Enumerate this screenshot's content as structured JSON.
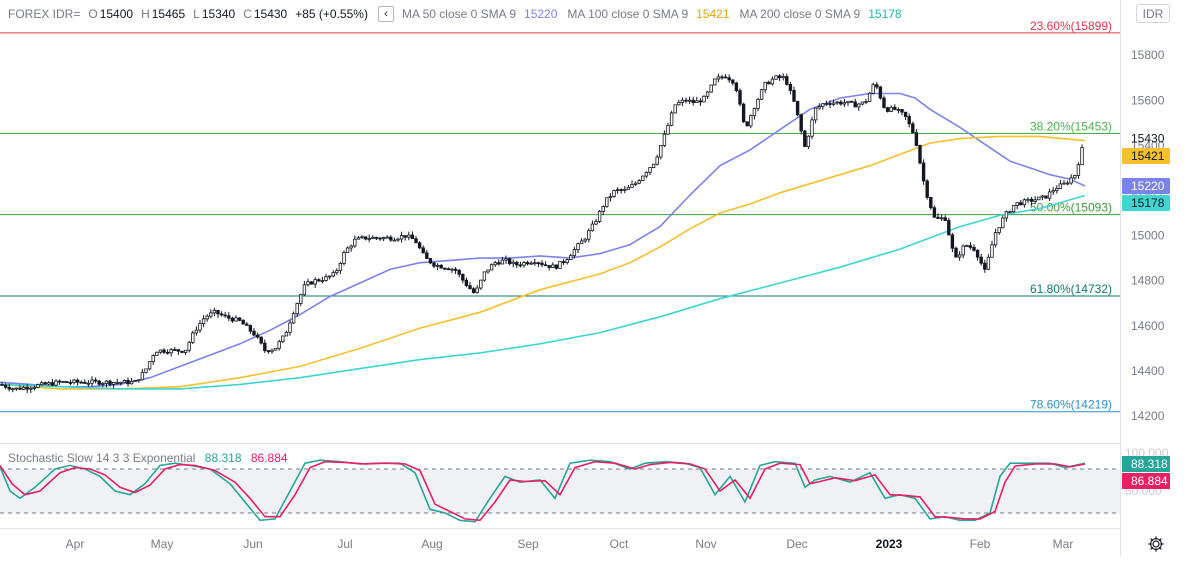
{
  "symbol": "FOREX IDR=",
  "ohlc": {
    "o_label": "O",
    "o": "15400",
    "h_label": "H",
    "h": "15465",
    "l_label": "L",
    "l": "15340",
    "c_label": "C",
    "c": "15430",
    "change": "+85 (+0.55%)"
  },
  "collapse_glyph": "‹",
  "currency_button": "IDR",
  "moving_averages": [
    {
      "name": "MA 50 close 0 SMA 9",
      "value": "15220",
      "color": "#7b83eb"
    },
    {
      "name": "MA 100 close 0 SMA 9",
      "value": "15421",
      "color": "#f5c02c"
    },
    {
      "name": "MA 200 close 0 SMA 9",
      "value": "15178",
      "color": "#3dd6d0"
    }
  ],
  "price_axis": {
    "ticks": [
      "15800",
      "15600",
      "15400",
      "15200",
      "15000",
      "14800",
      "14600",
      "14400",
      "14200"
    ],
    "last_price": "15430",
    "badges": [
      {
        "text": "15421",
        "bg": "#f5c02c",
        "color": "#131722"
      },
      {
        "text": "15220",
        "bg": "#7b83eb",
        "color": "#ffffff"
      },
      {
        "text": "15178",
        "bg": "#3dd6d0",
        "color": "#131722"
      }
    ]
  },
  "fib_levels": [
    {
      "label": "23.60%(15899)",
      "value": 15899,
      "color": "#e0364a"
    },
    {
      "label": "38.20%(15453)",
      "value": 15453,
      "color": "#4caf50"
    },
    {
      "label": "50.00%(15093)",
      "value": 15093,
      "color": "#3d9a3d"
    },
    {
      "label": "61.80%(14732)",
      "value": 14732,
      "color": "#0e7a6e"
    },
    {
      "label": "78.60%(14219)",
      "value": 14219,
      "color": "#2f8fd0"
    }
  ],
  "stochastic": {
    "name": "Stochastic Slow 14 3 3 Exponential",
    "k": "88.318",
    "d": "86.884",
    "k_color": "#26a69a",
    "d_color": "#e91e63",
    "axis_ticks": [
      "100.000",
      "50.000"
    ],
    "upper_band": 80,
    "lower_band": 20
  },
  "time_axis": [
    "Apr",
    "May",
    "Jun",
    "Jul",
    "Aug",
    "Sep",
    "Oct",
    "Nov",
    "Dec",
    "2023",
    "Feb",
    "Mar"
  ],
  "chart_data": {
    "type": "candlestick",
    "title": "",
    "ylim": [
      14170,
      15930
    ],
    "series": [
      {
        "name": "MA 50 close 0 SMA 9",
        "points": [
          [
            0,
            14350
          ],
          [
            30,
            14340
          ],
          [
            60,
            14330
          ],
          [
            90,
            14330
          ],
          [
            120,
            14340
          ],
          [
            150,
            14370
          ],
          [
            180,
            14420
          ],
          [
            210,
            14470
          ],
          [
            240,
            14520
          ],
          [
            270,
            14580
          ],
          [
            300,
            14650
          ],
          [
            330,
            14730
          ],
          [
            360,
            14790
          ],
          [
            390,
            14850
          ],
          [
            420,
            14880
          ],
          [
            450,
            14890
          ],
          [
            480,
            14900
          ],
          [
            510,
            14900
          ],
          [
            540,
            14910
          ],
          [
            570,
            14900
          ],
          [
            600,
            14920
          ],
          [
            630,
            14960
          ],
          [
            660,
            15040
          ],
          [
            690,
            15180
          ],
          [
            720,
            15310
          ],
          [
            750,
            15380
          ],
          [
            780,
            15470
          ],
          [
            810,
            15560
          ],
          [
            840,
            15610
          ],
          [
            870,
            15630
          ],
          [
            900,
            15630
          ],
          [
            915,
            15610
          ],
          [
            930,
            15560
          ],
          [
            960,
            15480
          ],
          [
            990,
            15390
          ],
          [
            1010,
            15330
          ],
          [
            1030,
            15300
          ],
          [
            1050,
            15270
          ],
          [
            1070,
            15250
          ],
          [
            1085,
            15220
          ]
        ]
      },
      {
        "name": "MA 100 close 0 SMA 9",
        "points": [
          [
            0,
            14340
          ],
          [
            60,
            14320
          ],
          [
            120,
            14320
          ],
          [
            180,
            14330
          ],
          [
            240,
            14370
          ],
          [
            300,
            14420
          ],
          [
            360,
            14500
          ],
          [
            420,
            14590
          ],
          [
            480,
            14660
          ],
          [
            540,
            14760
          ],
          [
            600,
            14830
          ],
          [
            630,
            14880
          ],
          [
            660,
            14950
          ],
          [
            690,
            15030
          ],
          [
            720,
            15100
          ],
          [
            750,
            15140
          ],
          [
            780,
            15190
          ],
          [
            810,
            15230
          ],
          [
            840,
            15270
          ],
          [
            870,
            15310
          ],
          [
            900,
            15360
          ],
          [
            930,
            15410
          ],
          [
            960,
            15430
          ],
          [
            1000,
            15440
          ],
          [
            1040,
            15440
          ],
          [
            1085,
            15421
          ]
        ]
      },
      {
        "name": "MA 200 close 0 SMA 9",
        "points": [
          [
            0,
            14340
          ],
          [
            60,
            14330
          ],
          [
            120,
            14320
          ],
          [
            180,
            14320
          ],
          [
            240,
            14340
          ],
          [
            300,
            14370
          ],
          [
            360,
            14410
          ],
          [
            420,
            14450
          ],
          [
            480,
            14480
          ],
          [
            540,
            14520
          ],
          [
            600,
            14570
          ],
          [
            660,
            14640
          ],
          [
            720,
            14720
          ],
          [
            780,
            14790
          ],
          [
            840,
            14860
          ],
          [
            900,
            14940
          ],
          [
            960,
            15040
          ],
          [
            1000,
            15090
          ],
          [
            1040,
            15120
          ],
          [
            1085,
            15178
          ]
        ]
      }
    ],
    "candles_close_path": [
      [
        0,
        14340
      ],
      [
        15,
        14320
      ],
      [
        30,
        14330
      ],
      [
        45,
        14340
      ],
      [
        60,
        14350
      ],
      [
        75,
        14350
      ],
      [
        90,
        14350
      ],
      [
        105,
        14350
      ],
      [
        120,
        14350
      ],
      [
        135,
        14350
      ],
      [
        145,
        14400
      ],
      [
        155,
        14490
      ],
      [
        170,
        14490
      ],
      [
        185,
        14490
      ],
      [
        195,
        14580
      ],
      [
        205,
        14640
      ],
      [
        215,
        14660
      ],
      [
        225,
        14640
      ],
      [
        240,
        14620
      ],
      [
        255,
        14560
      ],
      [
        265,
        14490
      ],
      [
        275,
        14500
      ],
      [
        285,
        14560
      ],
      [
        295,
        14680
      ],
      [
        305,
        14780
      ],
      [
        315,
        14800
      ],
      [
        325,
        14810
      ],
      [
        335,
        14830
      ],
      [
        345,
        14930
      ],
      [
        355,
        14980
      ],
      [
        365,
        14990
      ],
      [
        375,
        14990
      ],
      [
        385,
        14990
      ],
      [
        395,
        14990
      ],
      [
        405,
        15000
      ],
      [
        415,
        14980
      ],
      [
        425,
        14900
      ],
      [
        435,
        14870
      ],
      [
        445,
        14860
      ],
      [
        455,
        14850
      ],
      [
        465,
        14790
      ],
      [
        475,
        14740
      ],
      [
        485,
        14840
      ],
      [
        495,
        14880
      ],
      [
        505,
        14890
      ],
      [
        515,
        14870
      ],
      [
        525,
        14880
      ],
      [
        535,
        14890
      ],
      [
        545,
        14870
      ],
      [
        555,
        14860
      ],
      [
        565,
        14890
      ],
      [
        575,
        14940
      ],
      [
        585,
        14990
      ],
      [
        595,
        15060
      ],
      [
        605,
        15150
      ],
      [
        615,
        15200
      ],
      [
        625,
        15200
      ],
      [
        635,
        15230
      ],
      [
        645,
        15280
      ],
      [
        655,
        15330
      ],
      [
        665,
        15450
      ],
      [
        675,
        15580
      ],
      [
        685,
        15600
      ],
      [
        695,
        15590
      ],
      [
        705,
        15610
      ],
      [
        715,
        15690
      ],
      [
        725,
        15710
      ],
      [
        735,
        15680
      ],
      [
        745,
        15470
      ],
      [
        755,
        15580
      ],
      [
        765,
        15670
      ],
      [
        775,
        15700
      ],
      [
        785,
        15700
      ],
      [
        795,
        15580
      ],
      [
        805,
        15390
      ],
      [
        815,
        15560
      ],
      [
        825,
        15590
      ],
      [
        835,
        15590
      ],
      [
        845,
        15590
      ],
      [
        855,
        15580
      ],
      [
        865,
        15590
      ],
      [
        875,
        15680
      ],
      [
        885,
        15560
      ],
      [
        895,
        15560
      ],
      [
        905,
        15530
      ],
      [
        915,
        15440
      ],
      [
        925,
        15210
      ],
      [
        935,
        15070
      ],
      [
        945,
        15080
      ],
      [
        955,
        14890
      ],
      [
        965,
        14960
      ],
      [
        975,
        14940
      ],
      [
        985,
        14840
      ],
      [
        995,
        15010
      ],
      [
        1005,
        15090
      ],
      [
        1015,
        15140
      ],
      [
        1025,
        15150
      ],
      [
        1035,
        15160
      ],
      [
        1045,
        15170
      ],
      [
        1055,
        15210
      ],
      [
        1065,
        15230
      ],
      [
        1075,
        15270
      ],
      [
        1085,
        15430
      ]
    ],
    "stochastic_k": [
      [
        0,
        83
      ],
      [
        10,
        50
      ],
      [
        20,
        40
      ],
      [
        35,
        55
      ],
      [
        55,
        80
      ],
      [
        70,
        85
      ],
      [
        85,
        80
      ],
      [
        100,
        70
      ],
      [
        115,
        50
      ],
      [
        130,
        45
      ],
      [
        145,
        60
      ],
      [
        160,
        85
      ],
      [
        175,
        88
      ],
      [
        190,
        85
      ],
      [
        210,
        80
      ],
      [
        230,
        60
      ],
      [
        245,
        35
      ],
      [
        260,
        10
      ],
      [
        275,
        12
      ],
      [
        290,
        50
      ],
      [
        305,
        88
      ],
      [
        320,
        92
      ],
      [
        340,
        90
      ],
      [
        360,
        87
      ],
      [
        380,
        88
      ],
      [
        400,
        88
      ],
      [
        415,
        75
      ],
      [
        430,
        25
      ],
      [
        445,
        20
      ],
      [
        460,
        10
      ],
      [
        475,
        8
      ],
      [
        490,
        40
      ],
      [
        505,
        70
      ],
      [
        520,
        62
      ],
      [
        540,
        65
      ],
      [
        555,
        40
      ],
      [
        570,
        88
      ],
      [
        590,
        92
      ],
      [
        610,
        90
      ],
      [
        630,
        80
      ],
      [
        645,
        88
      ],
      [
        665,
        90
      ],
      [
        685,
        88
      ],
      [
        700,
        82
      ],
      [
        715,
        45
      ],
      [
        730,
        70
      ],
      [
        745,
        35
      ],
      [
        760,
        85
      ],
      [
        775,
        90
      ],
      [
        795,
        88
      ],
      [
        805,
        55
      ],
      [
        815,
        65
      ],
      [
        830,
        70
      ],
      [
        850,
        62
      ],
      [
        870,
        75
      ],
      [
        885,
        40
      ],
      [
        900,
        45
      ],
      [
        915,
        40
      ],
      [
        930,
        12
      ],
      [
        945,
        15
      ],
      [
        960,
        10
      ],
      [
        975,
        10
      ],
      [
        990,
        20
      ],
      [
        1000,
        70
      ],
      [
        1010,
        88
      ],
      [
        1030,
        88
      ],
      [
        1050,
        88
      ],
      [
        1065,
        82
      ],
      [
        1085,
        88
      ]
    ],
    "stochastic_d": [
      [
        0,
        85
      ],
      [
        12,
        60
      ],
      [
        25,
        45
      ],
      [
        40,
        50
      ],
      [
        60,
        75
      ],
      [
        75,
        82
      ],
      [
        90,
        80
      ],
      [
        105,
        72
      ],
      [
        120,
        55
      ],
      [
        135,
        48
      ],
      [
        150,
        58
      ],
      [
        165,
        80
      ],
      [
        180,
        86
      ],
      [
        195,
        85
      ],
      [
        215,
        78
      ],
      [
        235,
        62
      ],
      [
        250,
        40
      ],
      [
        265,
        15
      ],
      [
        280,
        15
      ],
      [
        295,
        45
      ],
      [
        310,
        82
      ],
      [
        325,
        90
      ],
      [
        345,
        89
      ],
      [
        365,
        87
      ],
      [
        385,
        88
      ],
      [
        405,
        87
      ],
      [
        420,
        78
      ],
      [
        435,
        32
      ],
      [
        450,
        22
      ],
      [
        465,
        12
      ],
      [
        480,
        10
      ],
      [
        495,
        35
      ],
      [
        510,
        65
      ],
      [
        525,
        63
      ],
      [
        545,
        64
      ],
      [
        560,
        45
      ],
      [
        575,
        82
      ],
      [
        595,
        90
      ],
      [
        615,
        88
      ],
      [
        635,
        80
      ],
      [
        650,
        86
      ],
      [
        670,
        89
      ],
      [
        690,
        87
      ],
      [
        705,
        80
      ],
      [
        720,
        50
      ],
      [
        735,
        65
      ],
      [
        750,
        40
      ],
      [
        765,
        80
      ],
      [
        780,
        88
      ],
      [
        800,
        86
      ],
      [
        810,
        60
      ],
      [
        820,
        63
      ],
      [
        835,
        68
      ],
      [
        855,
        64
      ],
      [
        875,
        72
      ],
      [
        890,
        45
      ],
      [
        905,
        44
      ],
      [
        920,
        42
      ],
      [
        935,
        15
      ],
      [
        950,
        14
      ],
      [
        965,
        12
      ],
      [
        980,
        12
      ],
      [
        995,
        22
      ],
      [
        1005,
        62
      ],
      [
        1015,
        84
      ],
      [
        1035,
        87
      ],
      [
        1055,
        87
      ],
      [
        1070,
        83
      ],
      [
        1085,
        86.884
      ]
    ]
  }
}
